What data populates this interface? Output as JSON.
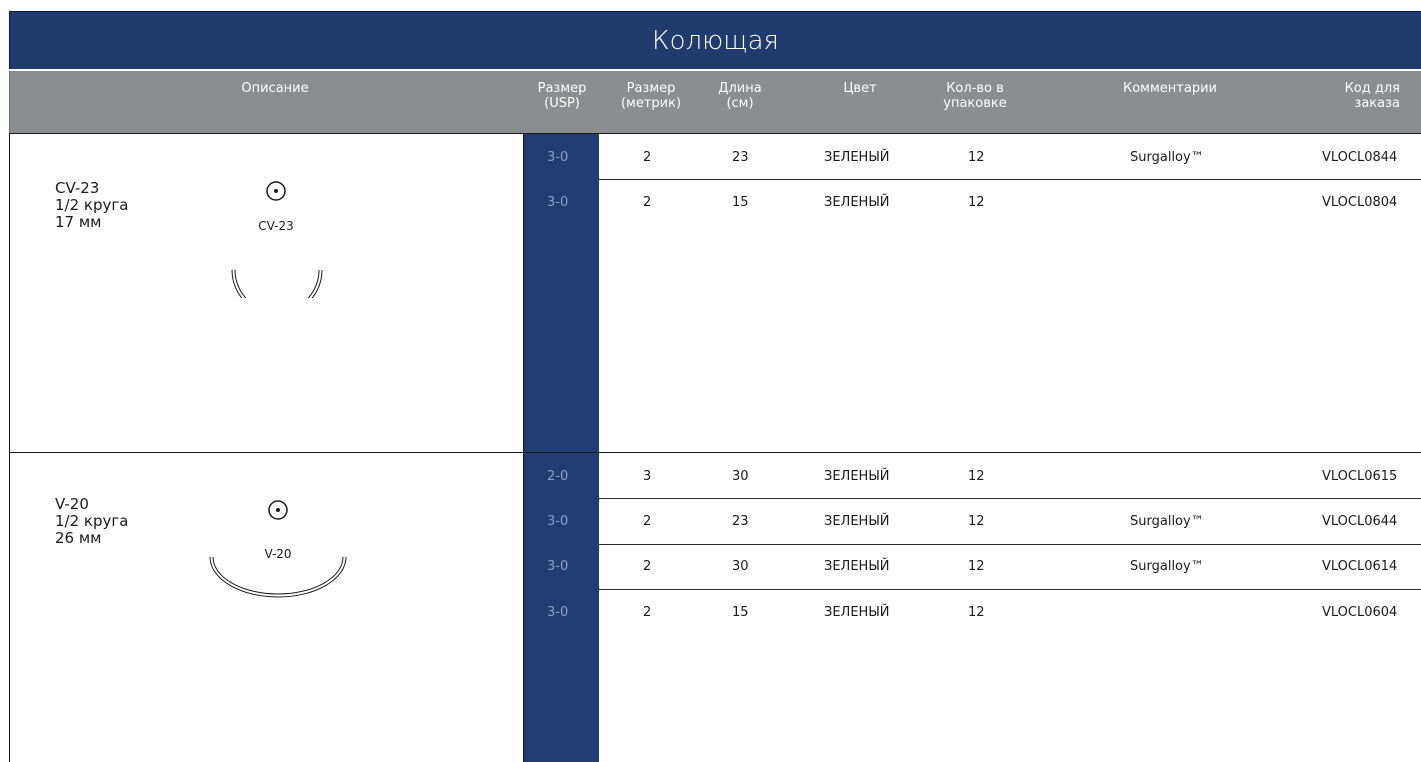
{
  "title": "Колющая",
  "headers": [
    "Описание",
    "Размер\n(USP)",
    "Размер\n(метрик)",
    "Длина\n(см)",
    "Цвет",
    "Кол-во в\nупаковке",
    "Комментарии",
    "Код для\nзаказа"
  ],
  "colors": {
    "title_bg": "#213b6f",
    "header_bg": "#8b8d90",
    "usp_column_bg": "#223d73",
    "usp_text": "#8aa0c9"
  },
  "groups": [
    {
      "name": "CV-23",
      "curve": "1/2 круга",
      "length": "17 мм",
      "icon": "needle-half-circle-icon",
      "rows": [
        {
          "usp": "3-0",
          "metric": "2",
          "length": "23",
          "color": "ЗЕЛЕНЫЙ",
          "qty": "12",
          "comment": "Surgalloy™",
          "code": "VLOCL0844"
        },
        {
          "usp": "3-0",
          "metric": "2",
          "length": "15",
          "color": "ЗЕЛЕНЫЙ",
          "qty": "12",
          "comment": "",
          "code": "VLOCL0804"
        }
      ]
    },
    {
      "name": "V-20",
      "curve": "1/2 круга",
      "length": "26 мм",
      "icon": "needle-half-circle-icon",
      "rows": [
        {
          "usp": "2-0",
          "metric": "3",
          "length": "30",
          "color": "ЗЕЛЕНЫЙ",
          "qty": "12",
          "comment": "",
          "code": "VLOCL0615"
        },
        {
          "usp": "3-0",
          "metric": "2",
          "length": "23",
          "color": "ЗЕЛЕНЫЙ",
          "qty": "12",
          "comment": "Surgalloy™",
          "code": "VLOCL0644"
        },
        {
          "usp": "3-0",
          "metric": "2",
          "length": "30",
          "color": "ЗЕЛЕНЫЙ",
          "qty": "12",
          "comment": "Surgalloy™",
          "code": "VLOCL0614"
        },
        {
          "usp": "3-0",
          "metric": "2",
          "length": "15",
          "color": "ЗЕЛЕНЫЙ",
          "qty": "12",
          "comment": "",
          "code": "VLOCL0604"
        }
      ]
    }
  ]
}
